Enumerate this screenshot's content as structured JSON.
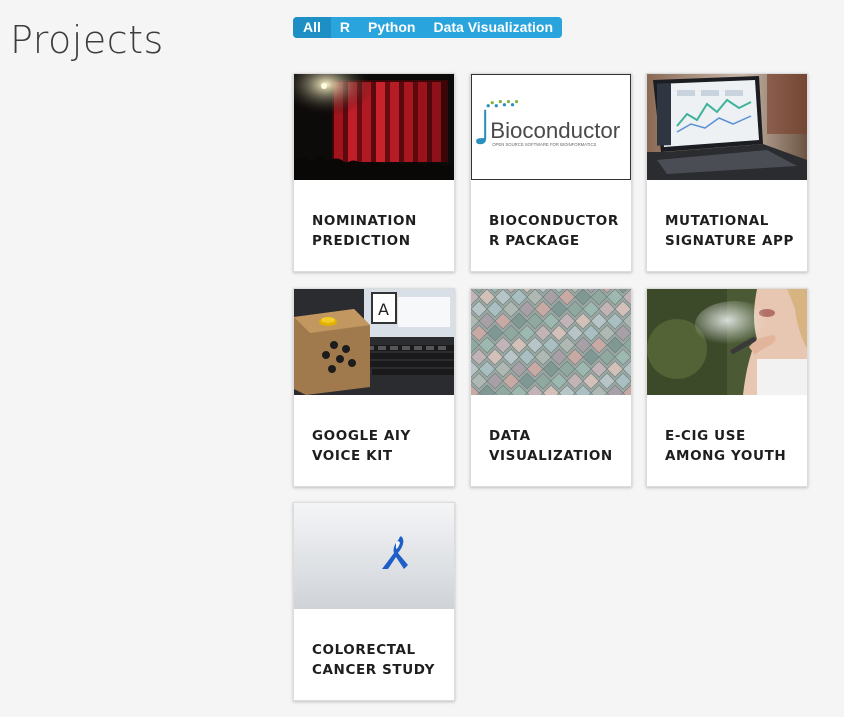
{
  "page": {
    "title": "Projects"
  },
  "filters": [
    {
      "label": "All",
      "active": true
    },
    {
      "label": "R",
      "active": false
    },
    {
      "label": "Python",
      "active": false
    },
    {
      "label": "Data Visualization",
      "active": false
    }
  ],
  "projects": [
    {
      "line1": "NOMINATION",
      "line2": "PREDICTION",
      "image": "stage-curtain-image"
    },
    {
      "line1": "BIOCONDUCTOR",
      "line2": "R PACKAGE",
      "image": "bioconductor-logo",
      "logo_text": "Bioconductor",
      "logo_subtext": "OPEN SOURCE SOFTWARE FOR BIOINFORMATICS"
    },
    {
      "line1": "MUTATIONAL",
      "line2": "SIGNATURE APP",
      "image": "laptop-dashboard-image"
    },
    {
      "line1": "GOOGLE AIY",
      "line2": "VOICE KIT",
      "image": "voice-kit-box-image"
    },
    {
      "line1": "DATA",
      "line2": "VISUALIZATION",
      "image": "colored-tiles-image"
    },
    {
      "line1": "E-CIG USE",
      "line2": "AMONG YOUTH",
      "image": "vaping-person-image"
    },
    {
      "line1": "COLORECTAL",
      "line2": "CANCER STUDY",
      "image": "blue-ribbon-image"
    }
  ],
  "colors": {
    "filter_bg": "#2aa4dc",
    "filter_active": "#1d8fc4",
    "page_bg": "#f5f5f5"
  }
}
